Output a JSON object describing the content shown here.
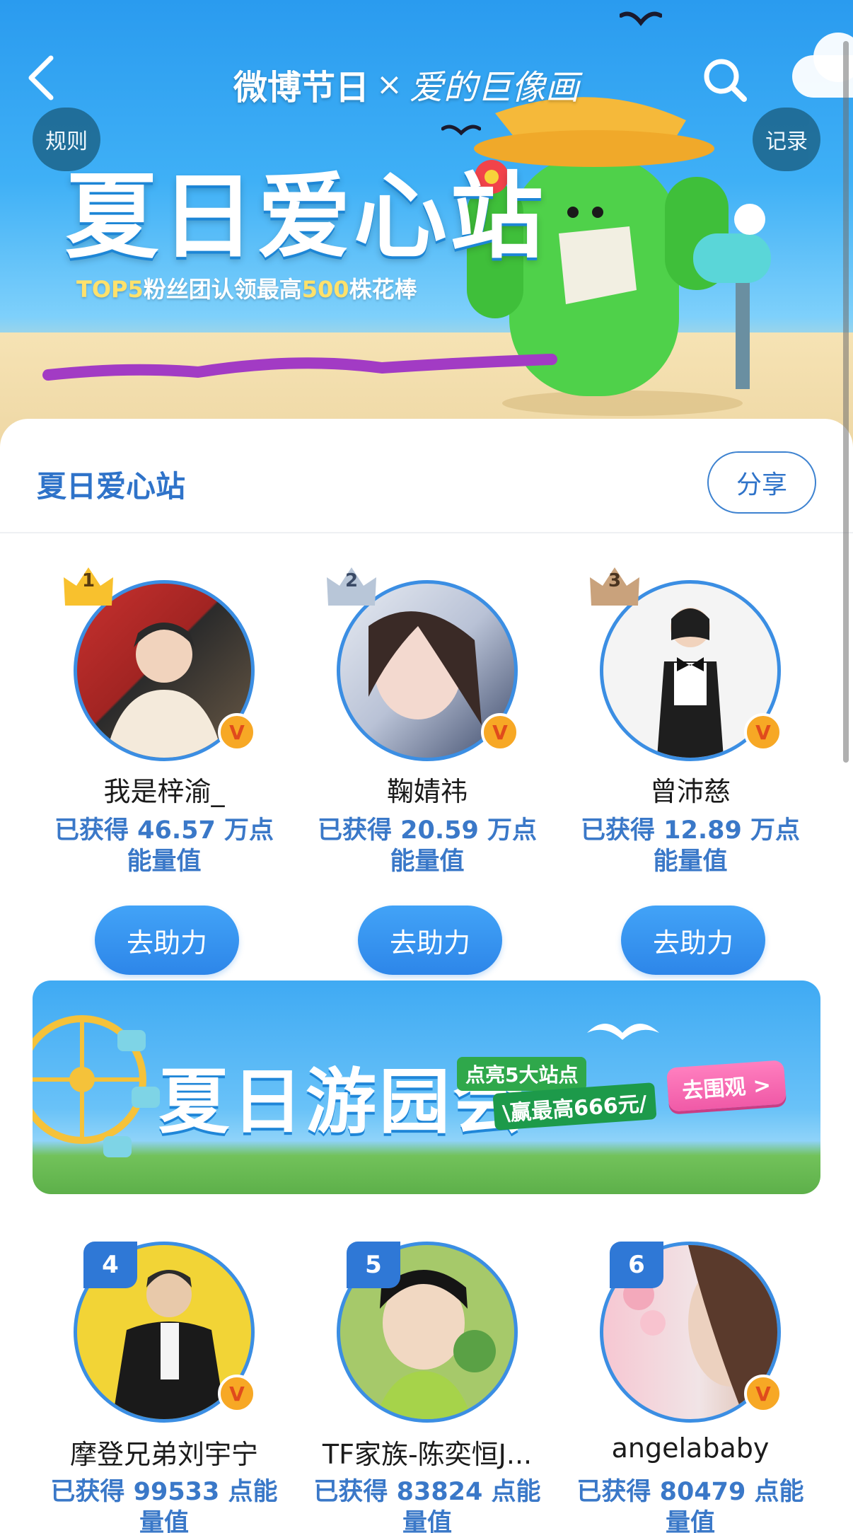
{
  "header": {
    "brand": "微博节日",
    "brand_x": "×",
    "brand2": "爱的巨像画",
    "rules_label": "规则",
    "records_label": "记录"
  },
  "hero": {
    "title": "夏日爱心站",
    "subtitle_prefix": "TOP5",
    "subtitle_mid": "粉丝团认领最高",
    "subtitle_num": "500",
    "subtitle_suffix": "株花棒"
  },
  "section": {
    "title": "夏日爱心站",
    "share_label": "分享"
  },
  "ranking": [
    {
      "rank": "1",
      "name": "我是梓渝_",
      "energy": "已获得 46.57 万点能量值",
      "button": "去助力"
    },
    {
      "rank": "2",
      "name": "鞠婧祎",
      "energy": "已获得 20.59 万点能量值",
      "button": "去助力"
    },
    {
      "rank": "3",
      "name": "曾沛慈",
      "energy": "已获得 12.89 万点能量值",
      "button": "去助力"
    },
    {
      "rank": "4",
      "name": "摩登兄弟刘宇宁",
      "energy": "已获得 99533 点能量值"
    },
    {
      "rank": "5",
      "name": "TF家族-陈奕恒J...",
      "energy": "已获得 83824 点能量值"
    },
    {
      "rank": "6",
      "name": "angelababy",
      "energy": "已获得 80479 点能量值"
    }
  ],
  "promo": {
    "title": "夏日游园会",
    "tag1": "点亮5大站点",
    "tag2": "\\赢最高666元/",
    "cta": "去围观 >"
  },
  "icons": {
    "back": "chevron-left-icon",
    "search": "search-icon",
    "verified": "verified-v-icon"
  },
  "colors": {
    "accent": "#2f73c9",
    "button": "#2d86e9",
    "badge": "#2f78d6",
    "verified": "#f7a825"
  }
}
